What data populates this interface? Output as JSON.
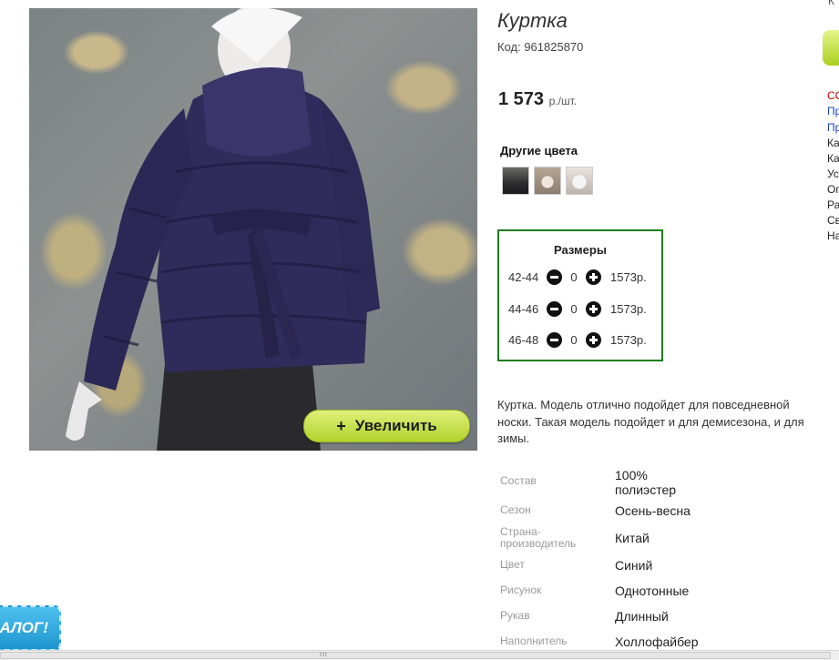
{
  "product": {
    "title": "Куртка",
    "code": "Код: 961825870",
    "price": "1 573",
    "price_unit": "р./шт.",
    "zoom_label": "Увеличить",
    "zoom_plus": "+",
    "other_colors_title": "Другие цвета",
    "other_colors": [
      "black-jacket-thumb",
      "beige-jacket-thumb",
      "white-jacket-thumb"
    ]
  },
  "sizes": {
    "title": "Размеры",
    "rows": [
      {
        "label": "42-44",
        "qty": "0",
        "price": "1573р."
      },
      {
        "label": "44-46",
        "qty": "0",
        "price": "1573р."
      },
      {
        "label": "46-48",
        "qty": "0",
        "price": "1573р."
      }
    ]
  },
  "description": "Куртка. Модель отлично подойдет для повседневной носки. Такая модель подойдет и для демисезона, и для зимы.",
  "specs": [
    {
      "key": "Состав",
      "value": "100% полиэстер"
    },
    {
      "key": "Сезон",
      "value": "Осень-весна"
    },
    {
      "key": "Страна-производитель",
      "value": "Китай"
    },
    {
      "key": "Цвет",
      "value": "Синий"
    },
    {
      "key": "Рисунок",
      "value": "Однотонные"
    },
    {
      "key": "Рукав",
      "value": "Длинный"
    },
    {
      "key": "Наполнитель",
      "value": "Холлофайбер"
    }
  ],
  "sidebar": {
    "top_char": "К",
    "items": [
      {
        "text": "СС",
        "color": "#cc0000"
      },
      {
        "text": "Пр",
        "color": "#1a3fbf"
      },
      {
        "text": "Пр",
        "color": "#1a3fbf"
      },
      {
        "text": "Ка",
        "color": "#222222"
      },
      {
        "text": "Ка",
        "color": "#222222"
      },
      {
        "text": "Ус",
        "color": "#222222"
      },
      {
        "text": "Оп",
        "color": "#222222"
      },
      {
        "text": "Ра",
        "color": "#222222"
      },
      {
        "text": "Св",
        "color": "#222222"
      },
      {
        "text": "На",
        "color": "#222222"
      }
    ]
  },
  "catalog_badge": "АЛОГ!",
  "scrollbar_grip": "III",
  "colors": {
    "sizes_border": "#1e7d1e",
    "zoom_button": "#c6e23a",
    "catalog_badge": "#2aa8dd"
  }
}
